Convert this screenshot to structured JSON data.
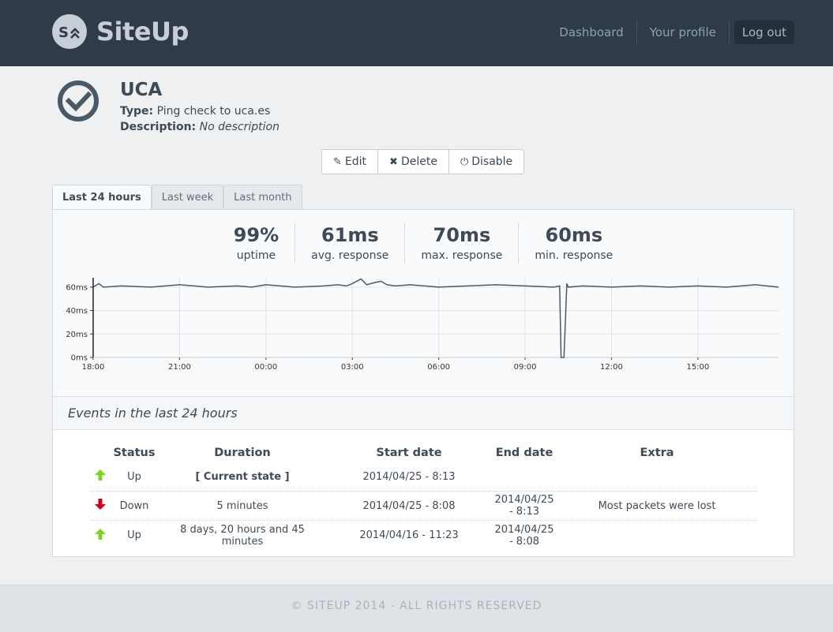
{
  "app": {
    "name": "SiteUp",
    "logo_text": "S"
  },
  "nav": {
    "dashboard": "Dashboard",
    "profile": "Your profile",
    "logout": "Log out"
  },
  "check": {
    "title": "UCA",
    "type_label": "Type:",
    "type_value": "Ping check to uca.es",
    "desc_label": "Description:",
    "desc_value": "No description",
    "status": "up"
  },
  "actions": {
    "edit": "Edit",
    "delete": "Delete",
    "disable": "Disable"
  },
  "tabs": [
    {
      "label": "Last 24 hours",
      "active": true
    },
    {
      "label": "Last week",
      "active": false
    },
    {
      "label": "Last month",
      "active": false
    }
  ],
  "stats": [
    {
      "value": "99%",
      "label": "uptime"
    },
    {
      "value": "61ms",
      "label": "avg. response"
    },
    {
      "value": "70ms",
      "label": "max. response"
    },
    {
      "value": "60ms",
      "label": "min. response"
    }
  ],
  "chart_data": {
    "type": "line",
    "ylabel_ticks": [
      "0ms",
      "20ms",
      "40ms",
      "60ms"
    ],
    "yticks": [
      0,
      20,
      40,
      60
    ],
    "ylim": [
      0,
      68
    ],
    "xticks": [
      "18:00",
      "21:00",
      "00:00",
      "03:00",
      "06:00",
      "09:00",
      "12:00",
      "15:00"
    ],
    "x_hours_range": [
      0,
      23.8
    ],
    "grid": true,
    "series": [
      {
        "color": "#4d5a66",
        "baseline": 60,
        "x": [
          0,
          0.2,
          0.35,
          1.0,
          2.0,
          3.0,
          4.0,
          5.0,
          5.5,
          6.0,
          7.0,
          8.0,
          8.5,
          8.8,
          9.0,
          9.3,
          9.5,
          9.8,
          10.0,
          10.2,
          10.5,
          11.0,
          12.0,
          13.0,
          14.0,
          15.0,
          16.0,
          16.2,
          16.25,
          16.35,
          16.45,
          16.5,
          17.0,
          18.0,
          19.0,
          20.0,
          21.0,
          22.0,
          23.0,
          23.8
        ],
        "y": [
          60,
          63,
          60,
          61,
          60,
          62,
          60,
          61,
          60,
          62,
          60,
          61,
          62,
          61,
          63,
          67,
          62,
          64,
          65,
          62,
          61,
          62,
          60,
          61,
          62,
          61,
          60,
          61,
          0,
          0,
          63,
          60,
          61,
          60,
          61,
          60,
          61,
          60,
          62,
          60
        ]
      }
    ]
  },
  "events": {
    "title": "Events in the last 24 hours",
    "columns": [
      "Status",
      "Duration",
      "Start date",
      "End date",
      "Extra"
    ],
    "rows": [
      {
        "direction": "up",
        "status": "Up",
        "duration": "[ Current state ]",
        "start": "2014/04/25 - 8:13",
        "end": "",
        "extra": ""
      },
      {
        "direction": "down",
        "status": "Down",
        "duration": "5 minutes",
        "start": "2014/04/25 - 8:08",
        "end": "2014/04/25 - 8:13",
        "extra": "Most packets were lost"
      },
      {
        "direction": "up",
        "status": "Up",
        "duration": "8 days, 20 hours and 45 minutes",
        "start": "2014/04/16 - 11:23",
        "end": "2014/04/25 - 8:08",
        "extra": ""
      }
    ]
  },
  "colors": {
    "up": "#7ed321",
    "down": "#d0021b",
    "header_bg": "#2f3b48"
  },
  "footer": "© SITEUP 2014 - ALL RIGHTS RESERVED"
}
